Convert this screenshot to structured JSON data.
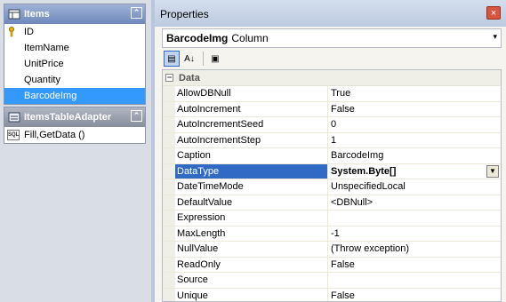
{
  "designer": {
    "items_table": {
      "title": "Items",
      "collapse_glyph": "⌃",
      "columns": [
        "ID",
        "ItemName",
        "UnitPrice",
        "Quantity",
        "BarcodeImg"
      ],
      "selected": "BarcodeImg"
    },
    "adapter": {
      "title": "ItemsTableAdapter",
      "collapse_glyph": "⌃",
      "sql_icon_text": "SQL",
      "methods": [
        "Fill,GetData ()"
      ]
    }
  },
  "properties": {
    "title": "Properties",
    "close_glyph": "×",
    "corner_text": "",
    "object": {
      "name": "BarcodeImg",
      "type": "Column",
      "dropdown_glyph": "▾"
    },
    "toolbar": {
      "categorized": "▤",
      "alphabetical": "A↓",
      "pages": "▣"
    },
    "category": {
      "name": "Data",
      "expander": "−"
    },
    "rows": [
      {
        "name": "AllowDBNull",
        "value": "True"
      },
      {
        "name": "AutoIncrement",
        "value": "False"
      },
      {
        "name": "AutoIncrementSeed",
        "value": "0"
      },
      {
        "name": "AutoIncrementStep",
        "value": "1"
      },
      {
        "name": "Caption",
        "value": "BarcodeImg"
      },
      {
        "name": "DataType",
        "value": "System.Byte[]"
      },
      {
        "name": "DateTimeMode",
        "value": "UnspecifiedLocal"
      },
      {
        "name": "DefaultValue",
        "value": "<DBNull>"
      },
      {
        "name": "Expression",
        "value": ""
      },
      {
        "name": "MaxLength",
        "value": "-1"
      },
      {
        "name": "NullValue",
        "value": "(Throw exception)"
      },
      {
        "name": "ReadOnly",
        "value": "False"
      },
      {
        "name": "Source",
        "value": ""
      },
      {
        "name": "Unique",
        "value": "False"
      }
    ],
    "selected_row": "DataType",
    "value_dropdown_glyph": "▼"
  },
  "colors": {
    "selection": "#316ac5",
    "designer_selection": "#3399ff",
    "table_header": "#6e88bb",
    "window_border": "#b9c5dc"
  }
}
